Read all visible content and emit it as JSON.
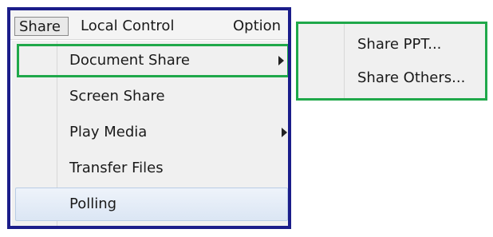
{
  "menubar": {
    "items": [
      "Share",
      "Local Control",
      "Option"
    ]
  },
  "dropdown": {
    "items": [
      {
        "label": "Document Share",
        "has_submenu": true
      },
      {
        "label": "Screen Share",
        "has_submenu": false
      },
      {
        "label": "Play Media",
        "has_submenu": true
      },
      {
        "label": "Transfer Files",
        "has_submenu": false
      },
      {
        "label": "Polling",
        "has_submenu": false
      }
    ]
  },
  "submenu": {
    "items": [
      {
        "label": "Share PPT..."
      },
      {
        "label": "Share Others..."
      }
    ]
  },
  "colors": {
    "frame": "#1b1d8a",
    "highlight": "#1fa84a",
    "hover": "#dbe6f4"
  }
}
